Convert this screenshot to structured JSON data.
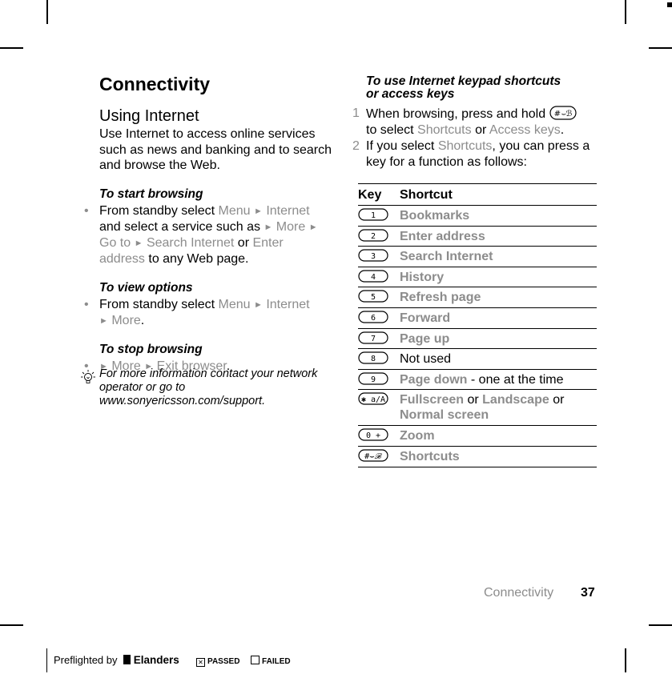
{
  "page": {
    "title": "Connectivity",
    "section_heading": "Using Internet",
    "intro": "Use Internet to access online services such as news and banking and to search and browse the Web.",
    "procedures": [
      {
        "title": "To start browsing",
        "text_parts": {
          "p1": "From standby select ",
          "menu": "Menu",
          "internet": "Internet",
          "p2": " and select a service such as ",
          "more": "More",
          "goto": "Go to",
          "search": "Search Internet",
          "or": " or ",
          "enter": "Enter address",
          "p3": " to any Web page."
        }
      },
      {
        "title": "To view options",
        "text_parts": {
          "p1": "From standby select ",
          "menu": "Menu",
          "internet": "Internet",
          "more": "More",
          "end": "."
        }
      },
      {
        "title": "To stop browsing",
        "text_parts": {
          "more": "More",
          "exit": "Exit browser",
          "end": "."
        }
      }
    ],
    "note": "For more information contact your network operator or go to www.sonyericsson.com/support.",
    "right_procedure": {
      "title_line1": "To use Internet keypad shortcuts",
      "title_line2": "or access keys",
      "steps": [
        {
          "num": "1",
          "p1": "When browsing, press and hold ",
          "p2": "to select ",
          "shortcuts": "Shortcuts",
          "or": " or ",
          "access_keys": "Access keys",
          "end": "."
        },
        {
          "num": "2",
          "p1": "If you select ",
          "shortcuts": "Shortcuts",
          "p2": ", you can press a key for a function as follows:"
        }
      ]
    },
    "table": {
      "headers": [
        "Key",
        "Shortcut"
      ],
      "rows": [
        {
          "key": "1",
          "shortcut": "Bookmarks"
        },
        {
          "key": "2",
          "shortcut": "Enter address"
        },
        {
          "key": "3",
          "shortcut": "Search Internet"
        },
        {
          "key": "4",
          "shortcut": "History"
        },
        {
          "key": "5",
          "shortcut": "Refresh page"
        },
        {
          "key": "6",
          "shortcut": "Forward"
        },
        {
          "key": "7",
          "shortcut": "Page up"
        },
        {
          "key": "8",
          "shortcut": "Not used"
        },
        {
          "key": "9",
          "shortcut": "Page down",
          "suffix": " - one at the time"
        },
        {
          "key": "*",
          "shortcut": "Fullscreen",
          "or1": " or ",
          "shortcut2": "Landscape",
          "or2": " or ",
          "shortcut3": "Normal screen"
        },
        {
          "key": "0 +",
          "shortcut": "Zoom"
        },
        {
          "key": "#",
          "shortcut": "Shortcuts"
        }
      ]
    },
    "footer": {
      "section": "Connectivity",
      "page_number": "37"
    },
    "preflight": {
      "label": "Preflighted by",
      "brand": "Elanders",
      "passed": "PASSED",
      "failed": "FAILED",
      "passed_checked": true
    },
    "colors": {
      "menu_gray": "#8c8c8c",
      "text": "#000000"
    }
  }
}
